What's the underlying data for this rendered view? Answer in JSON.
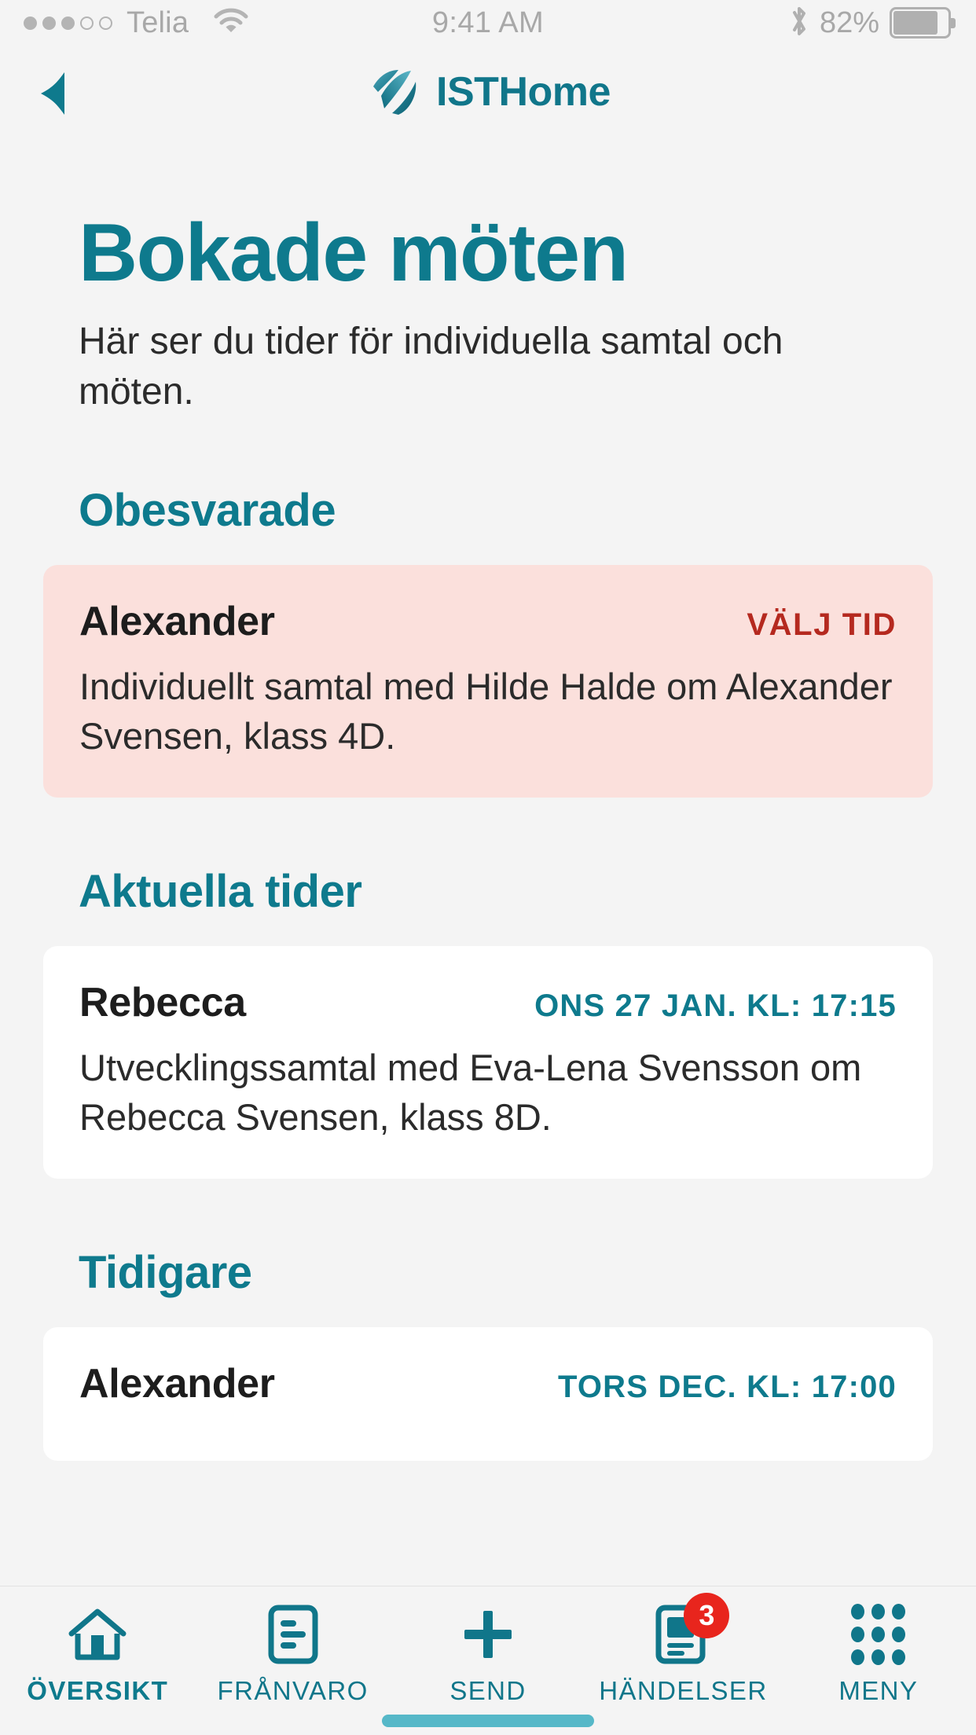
{
  "status_bar": {
    "signal_dots_filled": 3,
    "signal_dots_total": 5,
    "carrier": "Telia",
    "wifi_icon": "wifi-icon",
    "time": "9:41 AM",
    "bluetooth_icon": "bluetooth-icon",
    "battery_percent": "82%",
    "battery_level": 82
  },
  "navbar": {
    "back_icon": "back-triangle-icon",
    "logo_icon": "ist-logo-icon",
    "brand_primary": "IST",
    "brand_secondary": "Home"
  },
  "page": {
    "title": "Bokade möten",
    "subtitle": "Här ser du tider för individuella samtal och möten."
  },
  "sections": [
    {
      "heading": "Obesvarade",
      "card_style": "unanswered",
      "cards": [
        {
          "name": "Alexander",
          "meta": "VÄLJ TID",
          "meta_kind": "action",
          "body": "Individuellt samtal med Hilde Halde om Alexander Svensen, klass 4D."
        }
      ]
    },
    {
      "heading": "Aktuella tider",
      "card_style": "current",
      "cards": [
        {
          "name": "Rebecca",
          "meta": "ONS 27 JAN. KL: 17:15",
          "meta_kind": "time",
          "body": "Utvecklingssamtal med Eva-Lena Svensson om Rebecca Svensen, klass 8D."
        }
      ]
    },
    {
      "heading": "Tidigare",
      "card_style": "previous",
      "cards": [
        {
          "name": "Alexander",
          "meta": "TORS DEC. KL: 17:00",
          "meta_kind": "time",
          "body": ""
        }
      ]
    }
  ],
  "tabbar": {
    "items": [
      {
        "label": "ÖVERSIKT",
        "icon": "home-icon",
        "active": true,
        "badge": ""
      },
      {
        "label": "FRÅNVARO",
        "icon": "document-icon",
        "active": false,
        "badge": ""
      },
      {
        "label": "SEND",
        "icon": "plus-icon",
        "active": false,
        "badge": ""
      },
      {
        "label": "HÄNDELSER",
        "icon": "news-card-icon",
        "active": false,
        "badge": "3"
      },
      {
        "label": "MENY",
        "icon": "grid-dots-icon",
        "active": false,
        "badge": ""
      }
    ]
  },
  "colors": {
    "teal": "#0e7a8d",
    "brand_teal": "#10768a",
    "red_action": "#b5291f",
    "badge_red": "#e8251d",
    "pink_card": "#fbe0dc",
    "page_bg": "#f4f4f4",
    "white_card": "#ffffff",
    "home_indicator": "#56b8c8"
  }
}
